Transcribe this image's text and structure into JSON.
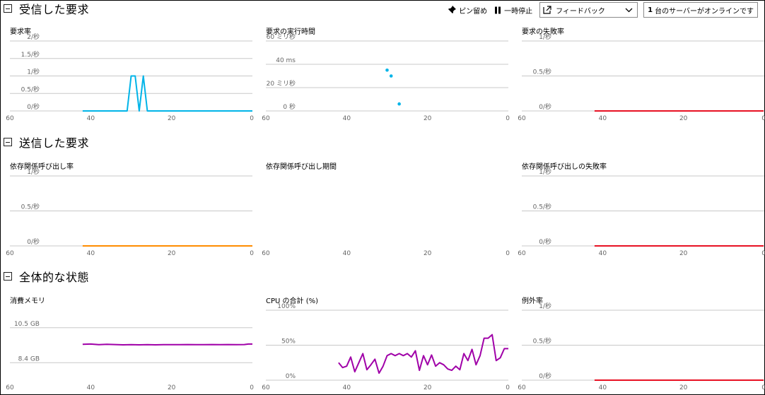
{
  "toolbar": {
    "pin_label": "ピン留め",
    "pause_label": "一時停止",
    "feedback_label": "フィードバック",
    "server_count": "1",
    "server_text": "台のサーバーがオンラインです"
  },
  "sections": [
    {
      "title": "受信した要求"
    },
    {
      "title": "送信した要求"
    },
    {
      "title": "全体的な状態"
    }
  ],
  "colors": {
    "request_rate": "#00B4E8",
    "duration": "#00B4E8",
    "failure": "#E81123",
    "dependency": "#FF8C00",
    "memory": "#A000A8",
    "cpu": "#A000A8",
    "grid": "#C8C8C8"
  },
  "x_axis_ticks": [
    "60",
    "40",
    "20",
    "0"
  ],
  "chart_data": [
    {
      "id": "request-rate",
      "title": "要求率",
      "type": "line",
      "y_ticks": [
        "2/秒",
        "1.5/秒",
        "1/秒",
        "0.5/秒",
        "0/秒"
      ],
      "ylim": [
        0,
        2
      ],
      "xlim": [
        60,
        0
      ],
      "color": "request_rate",
      "x": [
        42,
        31,
        30,
        29,
        28,
        27,
        26,
        25,
        20,
        10,
        0
      ],
      "y": [
        0,
        0,
        1,
        1,
        0,
        1,
        0,
        0,
        0,
        0,
        0
      ]
    },
    {
      "id": "request-duration",
      "title": "要求の実行時間",
      "type": "scatter",
      "y_ticks": [
        "60 ミリ秒",
        "40 ms",
        "20 ミリ秒",
        "0 秒"
      ],
      "ylim": [
        0,
        60
      ],
      "xlim": [
        60,
        0
      ],
      "color": "duration",
      "x": [
        30,
        29,
        27
      ],
      "y": [
        35,
        30,
        6
      ]
    },
    {
      "id": "request-failure",
      "title": "要求の失敗率",
      "type": "line",
      "y_ticks": [
        "1/秒",
        "0.5/秒",
        "0/秒"
      ],
      "ylim": [
        0,
        1
      ],
      "xlim": [
        60,
        -15
      ],
      "color": "failure",
      "x": [
        42,
        -15
      ],
      "y": [
        0,
        0
      ]
    },
    {
      "id": "dependency-rate",
      "title": "依存関係呼び出し率",
      "type": "line",
      "y_ticks": [
        "1/秒",
        "0.5/秒",
        "0/秒"
      ],
      "ylim": [
        0,
        1
      ],
      "xlim": [
        60,
        0
      ],
      "color": "dependency",
      "x": [
        42,
        0
      ],
      "y": [
        0,
        0
      ]
    },
    {
      "id": "dependency-duration",
      "title": "依存関係呼び出し期間",
      "type": "line",
      "y_ticks": [],
      "ylim": [
        0,
        1
      ],
      "xlim": [
        60,
        0
      ],
      "color": "dependency",
      "x": [],
      "y": []
    },
    {
      "id": "dependency-failure",
      "title": "依存関係呼び出しの失敗率",
      "type": "line",
      "y_ticks": [
        "1/秒",
        "0.5/秒",
        "0/秒"
      ],
      "ylim": [
        0,
        1
      ],
      "xlim": [
        60,
        -15
      ],
      "color": "failure",
      "x": [
        42,
        -15
      ],
      "y": [
        0,
        0
      ]
    },
    {
      "id": "committed-memory",
      "title": "消費メモリ",
      "type": "line",
      "y_ticks": [
        "10.5 GB",
        "8.4 GB"
      ],
      "y_tick_values": [
        10.5,
        8.4
      ],
      "ylim": [
        7.35,
        11.55
      ],
      "xlim": [
        60,
        0
      ],
      "color": "memory",
      "x": [
        42,
        40,
        38,
        36,
        34,
        32,
        30,
        28,
        26,
        24,
        22,
        20,
        18,
        16,
        14,
        12,
        10,
        8,
        6,
        4,
        2,
        1,
        0
      ],
      "y": [
        9.5,
        9.52,
        9.48,
        9.5,
        9.49,
        9.47,
        9.48,
        9.47,
        9.48,
        9.47,
        9.48,
        9.48,
        9.48,
        9.49,
        9.48,
        9.48,
        9.49,
        9.48,
        9.49,
        9.48,
        9.49,
        9.52,
        9.52
      ]
    },
    {
      "id": "cpu-total",
      "title": "CPU の合計 (%)",
      "type": "line",
      "y_ticks": [
        "100%",
        "50%",
        "0%"
      ],
      "ylim": [
        0,
        100
      ],
      "xlim": [
        60,
        0
      ],
      "color": "cpu",
      "x": [
        42,
        41,
        40,
        39,
        38,
        37,
        36,
        35,
        34,
        33,
        32,
        31,
        30,
        29,
        28,
        27,
        26,
        25,
        24,
        23,
        22,
        21,
        20,
        19,
        18,
        17,
        16,
        15,
        14,
        13,
        12,
        11,
        10,
        9,
        8,
        7,
        6,
        5,
        4,
        3,
        2,
        1,
        0
      ],
      "y": [
        25,
        18,
        20,
        33,
        12,
        25,
        38,
        15,
        22,
        30,
        10,
        20,
        35,
        38,
        35,
        38,
        35,
        38,
        33,
        42,
        14,
        35,
        22,
        36,
        20,
        25,
        22,
        16,
        14,
        20,
        15,
        38,
        28,
        44,
        22,
        35,
        60,
        60,
        65,
        28,
        32,
        45,
        45
      ]
    },
    {
      "id": "exception-rate",
      "title": "例外率",
      "type": "line",
      "y_ticks": [
        "1/秒",
        "0.5/秒",
        "0/秒"
      ],
      "ylim": [
        0,
        1
      ],
      "xlim": [
        60,
        -15
      ],
      "color": "failure",
      "x": [
        42,
        -15
      ],
      "y": [
        0,
        0
      ]
    }
  ]
}
